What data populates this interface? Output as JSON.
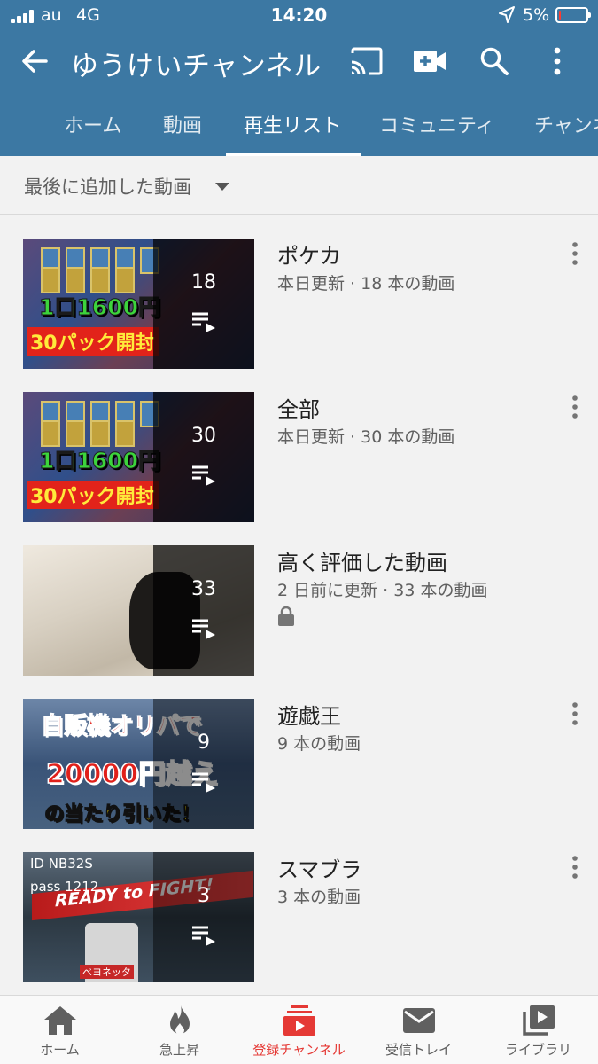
{
  "status_bar": {
    "carrier": "au",
    "network": "4G",
    "time": "14:20",
    "battery_text": "5%",
    "battery_level": 0.05
  },
  "app_bar": {
    "title": "ゆうけいチャンネル",
    "icons": [
      "back-icon",
      "cast-icon",
      "camera-icon",
      "search-icon",
      "more-icon"
    ]
  },
  "tabs": [
    {
      "label": "ホーム",
      "active": false
    },
    {
      "label": "動画",
      "active": false
    },
    {
      "label": "再生リスト",
      "active": true
    },
    {
      "label": "コミュニティ",
      "active": false
    },
    {
      "label": "チャンネル",
      "active": false
    }
  ],
  "sort": {
    "label": "最後に追加した動画"
  },
  "playlists": [
    {
      "title": "ポケカ",
      "meta": "本日更新 · 18 本の動画",
      "count": "18",
      "locked": false,
      "thumb_text": [
        "1口1600円",
        "30パック開封"
      ]
    },
    {
      "title": "全部",
      "meta": "本日更新 · 30 本の動画",
      "count": "30",
      "locked": false,
      "thumb_text": [
        "1口1600円",
        "30パック開封"
      ]
    },
    {
      "title": "高く評価した動画",
      "meta": "2 日前に更新 · 33 本の動画",
      "count": "33",
      "locked": true
    },
    {
      "title": "遊戯王",
      "meta": "9 本の動画",
      "count": "9",
      "locked": false,
      "thumb_text": [
        "自販機オリパで",
        "20000円越え",
        "の当たり引いた！"
      ]
    },
    {
      "title": "スマブラ",
      "meta": "3 本の動画",
      "count": "3",
      "locked": false,
      "thumb_text": [
        "ID NB32S",
        "pass 1212",
        "READY to FIGHT!",
        "ベヨネッタ"
      ]
    }
  ],
  "bottom_nav": [
    {
      "label": "ホーム",
      "icon": "home-icon",
      "active": false
    },
    {
      "label": "急上昇",
      "icon": "trending-icon",
      "active": false
    },
    {
      "label": "登録チャンネル",
      "icon": "subscriptions-icon",
      "active": true
    },
    {
      "label": "受信トレイ",
      "icon": "inbox-icon",
      "active": false
    },
    {
      "label": "ライブラリ",
      "icon": "library-icon",
      "active": false
    }
  ],
  "colors": {
    "header": "#3c78a3",
    "active_nav": "#e53935",
    "background": "#f2f2f2"
  }
}
